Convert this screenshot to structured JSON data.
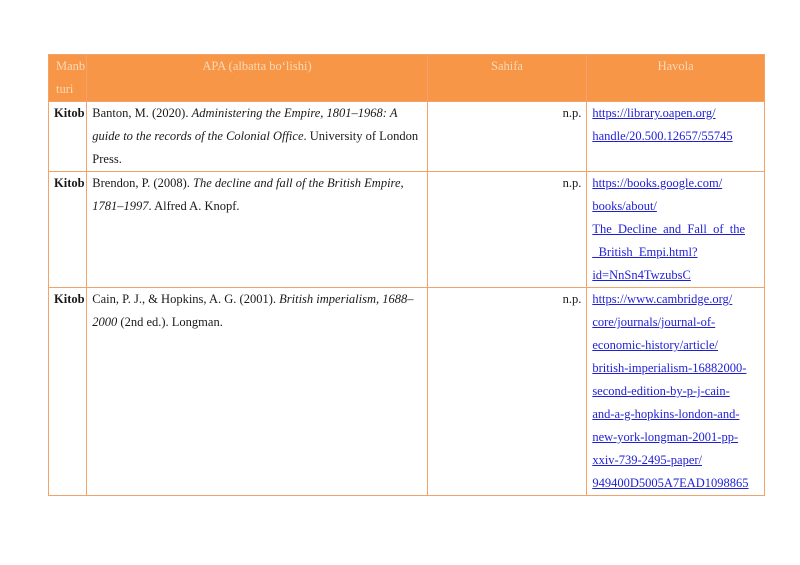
{
  "table": {
    "headers": {
      "type": "Manb turi",
      "apa": "APA (albatta bo‘lishi)",
      "page": "Sahifa",
      "link": "Havola"
    },
    "rows": [
      {
        "type": "Kitob",
        "apa_pre": "Banton, M. (2020). ",
        "apa_title": "Administering the Empire, 1801–1968: A guide to the records of the Colonial Office",
        "apa_post": ". University of London Press.",
        "page": "n.p.",
        "link_lines": [
          "https://library.oapen.org/",
          "handle/20.500.12657/55745"
        ]
      },
      {
        "type": "Kitob",
        "apa_pre": "Brendon, P. (2008). ",
        "apa_title": "The decline and fall of the British Empire, 1781–1997",
        "apa_post": ". Alfred A. Knopf.",
        "page": "n.p.",
        "link_lines": [
          "https://books.google.com/",
          "books/about/",
          "The_Decline_and_Fall_of_the",
          "_British_Empi.html?",
          "id=NnSn4TwzubsC"
        ]
      },
      {
        "type": "Kitob",
        "apa_pre": "Cain, P. J., & Hopkins, A. G. (2001). ",
        "apa_title": "British imperialism, 1688–2000",
        "apa_post": " (2nd ed.). Longman.",
        "page": "n.p.",
        "link_lines": [
          "https://www.cambridge.org/",
          "core/journals/journal-of-",
          "economic-history/article/",
          "british-imperialism-16882000-",
          "second-edition-by-p-j-cain-",
          "and-a-g-hopkins-london-and-",
          "new-york-longman-2001-pp-",
          "xxiv-739-2495-paper/",
          "949400D5005A7EAD1098865"
        ]
      }
    ]
  },
  "colors": {
    "header_bg": "#f79646",
    "header_text": "#fbd9b8",
    "border": "#f2a36b",
    "link": "#1f1fd6"
  }
}
